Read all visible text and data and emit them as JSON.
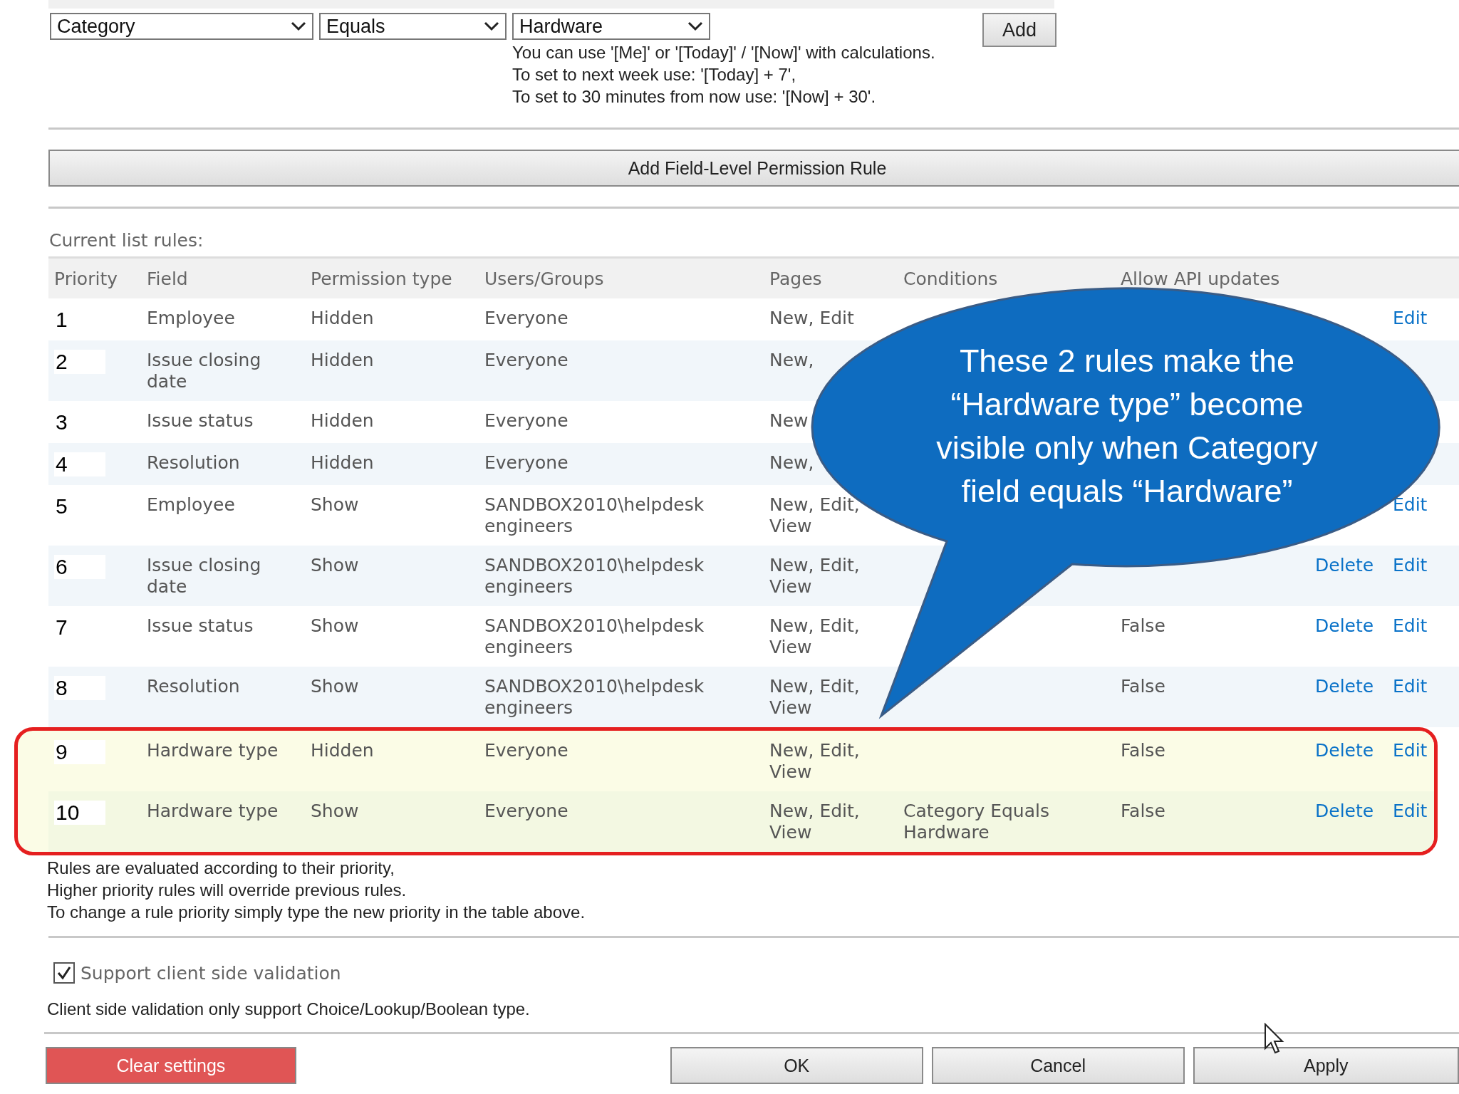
{
  "filter": {
    "field": "Category",
    "operator": "Equals",
    "value": "Hardware",
    "add_button": "Add",
    "hints": [
      "You can use '[Me]' or '[Today]' / '[Now]' with calculations.",
      "To set to next week use: '[Today] + 7',",
      "To set to 30 minutes from now use: '[Now] + 30'."
    ]
  },
  "add_rule_button": "Add Field-Level Permission Rule",
  "rules_title": "Current list rules:",
  "table": {
    "columns": [
      "Priority",
      "Field",
      "Permission type",
      "Users/Groups",
      "Pages",
      "Conditions",
      "Allow API updates"
    ],
    "rows": [
      {
        "priority": "1",
        "field": "Employee",
        "permission": "Hidden",
        "users": "Everyone",
        "pages": "New, Edit",
        "edit": "Edit",
        "highlighted": false
      },
      {
        "priority": "2",
        "field": "Issue closing date",
        "permission": "Hidden",
        "users": "Everyone",
        "pages": "New,",
        "highlighted": false
      },
      {
        "priority": "3",
        "field": "Issue status",
        "permission": "Hidden",
        "users": "Everyone",
        "pages": "New",
        "highlighted": false
      },
      {
        "priority": "4",
        "field": "Resolution",
        "permission": "Hidden",
        "users": "Everyone",
        "pages": "New,",
        "highlighted": false
      },
      {
        "priority": "5",
        "field": "Employee",
        "permission": "Show",
        "users": "SANDBOX2010\\helpdesk engineers",
        "pages": "New, Edit, View",
        "edit": "Edit",
        "highlighted": false
      },
      {
        "priority": "6",
        "field": "Issue closing date",
        "permission": "Show",
        "users": "SANDBOX2010\\helpdesk engineers",
        "pages": "New, Edit, View",
        "delete": "Delete",
        "edit": "Edit",
        "highlighted": false
      },
      {
        "priority": "7",
        "field": "Issue status",
        "permission": "Show",
        "users": "SANDBOX2010\\helpdesk engineers",
        "pages": "New, Edit, View",
        "api": "False",
        "delete": "Delete",
        "edit": "Edit",
        "highlighted": false
      },
      {
        "priority": "8",
        "field": "Resolution",
        "permission": "Show",
        "users": "SANDBOX2010\\helpdesk engineers",
        "pages": "New, Edit, View",
        "api": "False",
        "delete": "Delete",
        "edit": "Edit",
        "highlighted": false
      },
      {
        "priority": "9",
        "field": "Hardware type",
        "permission": "Hidden",
        "users": "Everyone",
        "pages": "New, Edit, View",
        "api": "False",
        "delete": "Delete",
        "edit": "Edit",
        "highlighted": true
      },
      {
        "priority": "10",
        "field": "Hardware type",
        "permission": "Show",
        "users": "Everyone",
        "pages": "New, Edit, View",
        "conditions": "Category Equals Hardware",
        "api": "False",
        "delete": "Delete",
        "edit": "Edit",
        "highlighted": true
      }
    ]
  },
  "notes": [
    "Rules are evaluated according to their priority,",
    "Higher priority rules will override previous rules.",
    "To change a rule priority simply type the new priority in the table above."
  ],
  "client_validation": {
    "label": "Support client side validation",
    "checked": true
  },
  "validation_note": "Client side validation only support Choice/Lookup/Boolean type.",
  "buttons": {
    "clear": "Clear settings",
    "ok": "OK",
    "cancel": "Cancel",
    "apply": "Apply"
  },
  "callout": {
    "lines": [
      "These 2 rules make the",
      "“Hardware type” become",
      "visible only when Category",
      "field equals “Hardware”"
    ]
  }
}
